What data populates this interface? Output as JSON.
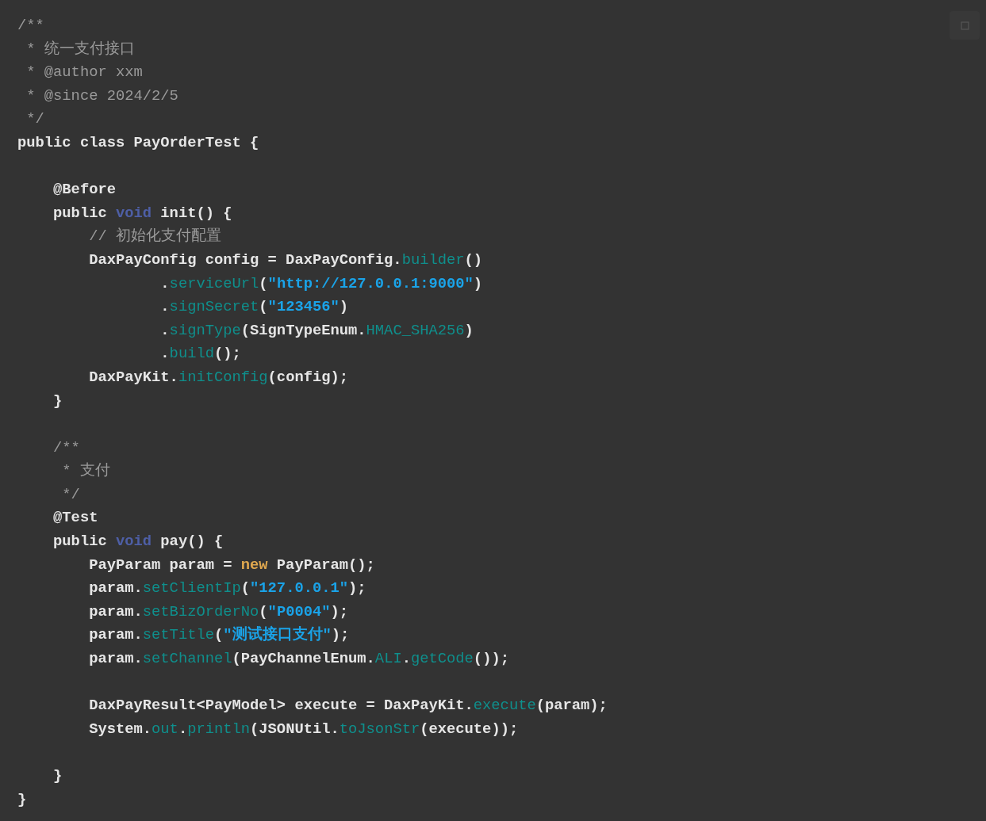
{
  "code_block": {
    "lines": [
      {
        "kind": "code",
        "tokens": [
          {
            "kind": "comment",
            "text": "/**"
          }
        ]
      },
      {
        "kind": "code",
        "tokens": [
          {
            "kind": "comment",
            "text": " * 统一支付接口"
          }
        ]
      },
      {
        "kind": "code",
        "tokens": [
          {
            "kind": "comment",
            "text": " * @author xxm"
          }
        ]
      },
      {
        "kind": "code",
        "tokens": [
          {
            "kind": "comment",
            "text": " * @since 2024/2/5"
          }
        ]
      },
      {
        "kind": "code",
        "tokens": [
          {
            "kind": "comment",
            "text": " */"
          }
        ]
      },
      {
        "kind": "code",
        "tokens": [
          {
            "kind": "plain",
            "text": "public class PayOrderTest {"
          }
        ]
      },
      {
        "kind": "blank"
      },
      {
        "kind": "code",
        "tokens": [
          {
            "kind": "plain",
            "text": "    @Before"
          }
        ]
      },
      {
        "kind": "code",
        "tokens": [
          {
            "kind": "plain",
            "text": "    public "
          },
          {
            "kind": "type",
            "text": "void"
          },
          {
            "kind": "plain",
            "text": " init() {"
          }
        ]
      },
      {
        "kind": "code",
        "tokens": [
          {
            "kind": "comment",
            "text": "        // 初始化支付配置"
          }
        ]
      },
      {
        "kind": "code",
        "tokens": [
          {
            "kind": "plain",
            "text": "        DaxPayConfig config = DaxPayConfig."
          },
          {
            "kind": "method",
            "text": "builder"
          },
          {
            "kind": "plain",
            "text": "()"
          }
        ]
      },
      {
        "kind": "code",
        "tokens": [
          {
            "kind": "plain",
            "text": "                ."
          },
          {
            "kind": "method",
            "text": "serviceUrl"
          },
          {
            "kind": "plain",
            "text": "("
          },
          {
            "kind": "string",
            "text": "\"http://127.0.0.1:9000\""
          },
          {
            "kind": "plain",
            "text": ")"
          }
        ]
      },
      {
        "kind": "code",
        "tokens": [
          {
            "kind": "plain",
            "text": "                ."
          },
          {
            "kind": "method",
            "text": "signSecret"
          },
          {
            "kind": "plain",
            "text": "("
          },
          {
            "kind": "string",
            "text": "\"123456\""
          },
          {
            "kind": "plain",
            "text": ")"
          }
        ]
      },
      {
        "kind": "code",
        "tokens": [
          {
            "kind": "plain",
            "text": "                ."
          },
          {
            "kind": "method",
            "text": "signType"
          },
          {
            "kind": "plain",
            "text": "(SignTypeEnum."
          },
          {
            "kind": "method",
            "text": "HMAC_SHA256"
          },
          {
            "kind": "plain",
            "text": ")"
          }
        ]
      },
      {
        "kind": "code",
        "tokens": [
          {
            "kind": "plain",
            "text": "                ."
          },
          {
            "kind": "method",
            "text": "build"
          },
          {
            "kind": "plain",
            "text": "();"
          }
        ]
      },
      {
        "kind": "code",
        "tokens": [
          {
            "kind": "plain",
            "text": "        DaxPayKit."
          },
          {
            "kind": "method",
            "text": "initConfig"
          },
          {
            "kind": "plain",
            "text": "(config);"
          }
        ]
      },
      {
        "kind": "code",
        "tokens": [
          {
            "kind": "plain",
            "text": "    }"
          }
        ]
      },
      {
        "kind": "blank"
      },
      {
        "kind": "code",
        "tokens": [
          {
            "kind": "comment",
            "text": "    /**"
          }
        ]
      },
      {
        "kind": "code",
        "tokens": [
          {
            "kind": "comment",
            "text": "     * 支付"
          }
        ]
      },
      {
        "kind": "code",
        "tokens": [
          {
            "kind": "comment",
            "text": "     */"
          }
        ]
      },
      {
        "kind": "code",
        "tokens": [
          {
            "kind": "plain",
            "text": "    @Test"
          }
        ]
      },
      {
        "kind": "code",
        "tokens": [
          {
            "kind": "plain",
            "text": "    public "
          },
          {
            "kind": "type",
            "text": "void"
          },
          {
            "kind": "plain",
            "text": " pay() {"
          }
        ]
      },
      {
        "kind": "code",
        "tokens": [
          {
            "kind": "plain",
            "text": "        PayParam param = "
          },
          {
            "kind": "new",
            "text": "new"
          },
          {
            "kind": "plain",
            "text": " PayParam();"
          }
        ]
      },
      {
        "kind": "code",
        "tokens": [
          {
            "kind": "plain",
            "text": "        param."
          },
          {
            "kind": "method",
            "text": "setClientIp"
          },
          {
            "kind": "plain",
            "text": "("
          },
          {
            "kind": "string",
            "text": "\"127.0.0.1\""
          },
          {
            "kind": "plain",
            "text": ");"
          }
        ]
      },
      {
        "kind": "code",
        "tokens": [
          {
            "kind": "plain",
            "text": "        param."
          },
          {
            "kind": "method",
            "text": "setBizOrderNo"
          },
          {
            "kind": "plain",
            "text": "("
          },
          {
            "kind": "string",
            "text": "\"P0004\""
          },
          {
            "kind": "plain",
            "text": ");"
          }
        ]
      },
      {
        "kind": "code",
        "tokens": [
          {
            "kind": "plain",
            "text": "        param."
          },
          {
            "kind": "method",
            "text": "setTitle"
          },
          {
            "kind": "plain",
            "text": "("
          },
          {
            "kind": "string",
            "text": "\"测试接口支付\""
          },
          {
            "kind": "plain",
            "text": ");"
          }
        ]
      },
      {
        "kind": "code",
        "tokens": [
          {
            "kind": "plain",
            "text": "        param."
          },
          {
            "kind": "method",
            "text": "setChannel"
          },
          {
            "kind": "plain",
            "text": "(PayChannelEnum."
          },
          {
            "kind": "method",
            "text": "ALI"
          },
          {
            "kind": "plain",
            "text": "."
          },
          {
            "kind": "method",
            "text": "getCode"
          },
          {
            "kind": "plain",
            "text": "());"
          }
        ]
      },
      {
        "kind": "blank"
      },
      {
        "kind": "code",
        "tokens": [
          {
            "kind": "plain",
            "text": "        DaxPayResult<PayModel> execute = DaxPayKit."
          },
          {
            "kind": "method",
            "text": "execute"
          },
          {
            "kind": "plain",
            "text": "(param);"
          }
        ]
      },
      {
        "kind": "code",
        "tokens": [
          {
            "kind": "plain",
            "text": "        System."
          },
          {
            "kind": "method",
            "text": "out"
          },
          {
            "kind": "plain",
            "text": "."
          },
          {
            "kind": "method",
            "text": "println"
          },
          {
            "kind": "plain",
            "text": "(JSONUtil."
          },
          {
            "kind": "method",
            "text": "toJsonStr"
          },
          {
            "kind": "plain",
            "text": "(execute));"
          }
        ]
      },
      {
        "kind": "blank"
      },
      {
        "kind": "code",
        "tokens": [
          {
            "kind": "plain",
            "text": "    }"
          }
        ]
      },
      {
        "kind": "code",
        "tokens": [
          {
            "kind": "plain",
            "text": "}"
          }
        ]
      }
    ]
  }
}
